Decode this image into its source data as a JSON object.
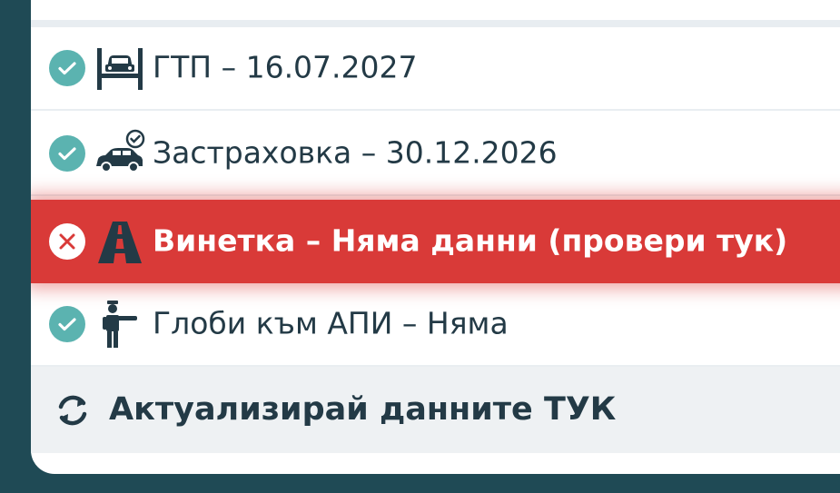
{
  "checks": [
    {
      "status": "ok",
      "icon": "car-lift-icon",
      "label": "ГТП – 16.07.2027"
    },
    {
      "status": "ok",
      "icon": "car-insurance-icon",
      "label": "Застраховка – 30.12.2026"
    },
    {
      "status": "error",
      "icon": "road-icon",
      "label": "Винетка – Няма данни (провери тук)"
    },
    {
      "status": "ok",
      "icon": "traffic-officer-icon",
      "label": "Глоби към АПИ – Няма"
    }
  ],
  "refresh": {
    "icon": "refresh-icon",
    "label": "Актуализирай данните ТУК"
  },
  "colors": {
    "ok": "#5bb3b0",
    "error": "#d93a38",
    "text": "#233a46",
    "background": "#1f4a55"
  }
}
